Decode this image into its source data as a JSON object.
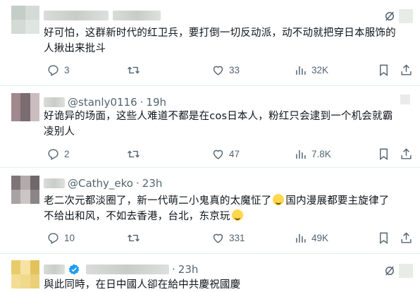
{
  "tweets": [
    {
      "handle": "",
      "time": "",
      "verified": false,
      "text_lines": [
        "好可怕，这群新时代的红卫兵，要打倒一切反动派，动不动就把穿日本服饰的",
        "人揪出来批斗"
      ],
      "emoji_after_line": [],
      "stats": {
        "replies": "3",
        "retweets": "",
        "likes": "33",
        "views": "32K"
      }
    },
    {
      "handle": "@stanly0116",
      "time": "19h",
      "verified": false,
      "text_lines": [
        "好诡异的场面，这些人难道不都是在cos日本人，粉红只会逮到一个机会就霸",
        "凌别人"
      ],
      "stats": {
        "replies": "2",
        "retweets": "",
        "likes": "47",
        "views": "7.8K"
      }
    },
    {
      "handle": "@Cathy_eko",
      "time": "23h",
      "verified": false,
      "text_lines": [
        "老二次元都淡圈了，新一代萌二小鬼真的太魔怔了",
        "国内漫展都要主旋律了",
        "不给出和风，不如去香港，台北，东京玩"
      ],
      "stats": {
        "replies": "10",
        "retweets": "",
        "likes": "331",
        "views": "49K"
      }
    },
    {
      "handle": "",
      "time": "23h",
      "verified": true,
      "text_lines": [
        "與此同時，在日中國人卻在給中共慶祝國慶"
      ],
      "stats": {}
    }
  ],
  "icons": {
    "reply": "reply-icon",
    "retweet": "retweet-icon",
    "like": "like-icon",
    "views": "views-icon",
    "bookmark": "bookmark-icon",
    "share": "share-icon",
    "grok": "grok-icon"
  },
  "colors": {
    "text": "#0f1419",
    "muted": "#536471",
    "divider": "#e6ecf0",
    "verified": "#1d9bf0"
  }
}
